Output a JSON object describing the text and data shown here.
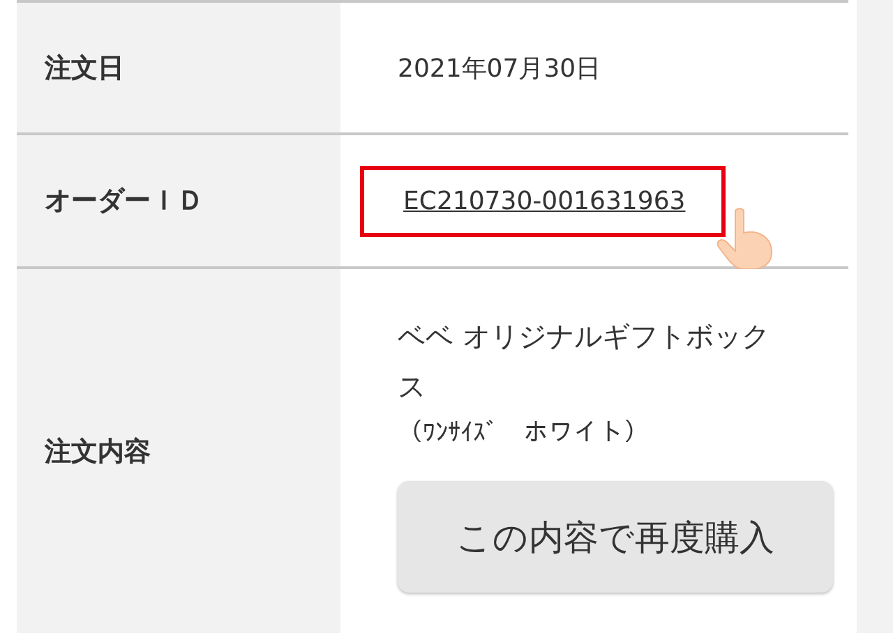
{
  "rows": [
    {
      "kind": "text",
      "label": "注文日",
      "value": "2021年07月30日"
    },
    {
      "kind": "link",
      "label": "オーダーＩＤ",
      "value": "EC210730-001631963",
      "highlighted": true
    },
    {
      "kind": "product",
      "label": "注文内容",
      "product_name": "ベベ オリジナルギフトボックス",
      "variant": "（ﾜﾝｻｲｽﾞ　ホワイト）",
      "button": "この内容で再度購入"
    }
  ]
}
